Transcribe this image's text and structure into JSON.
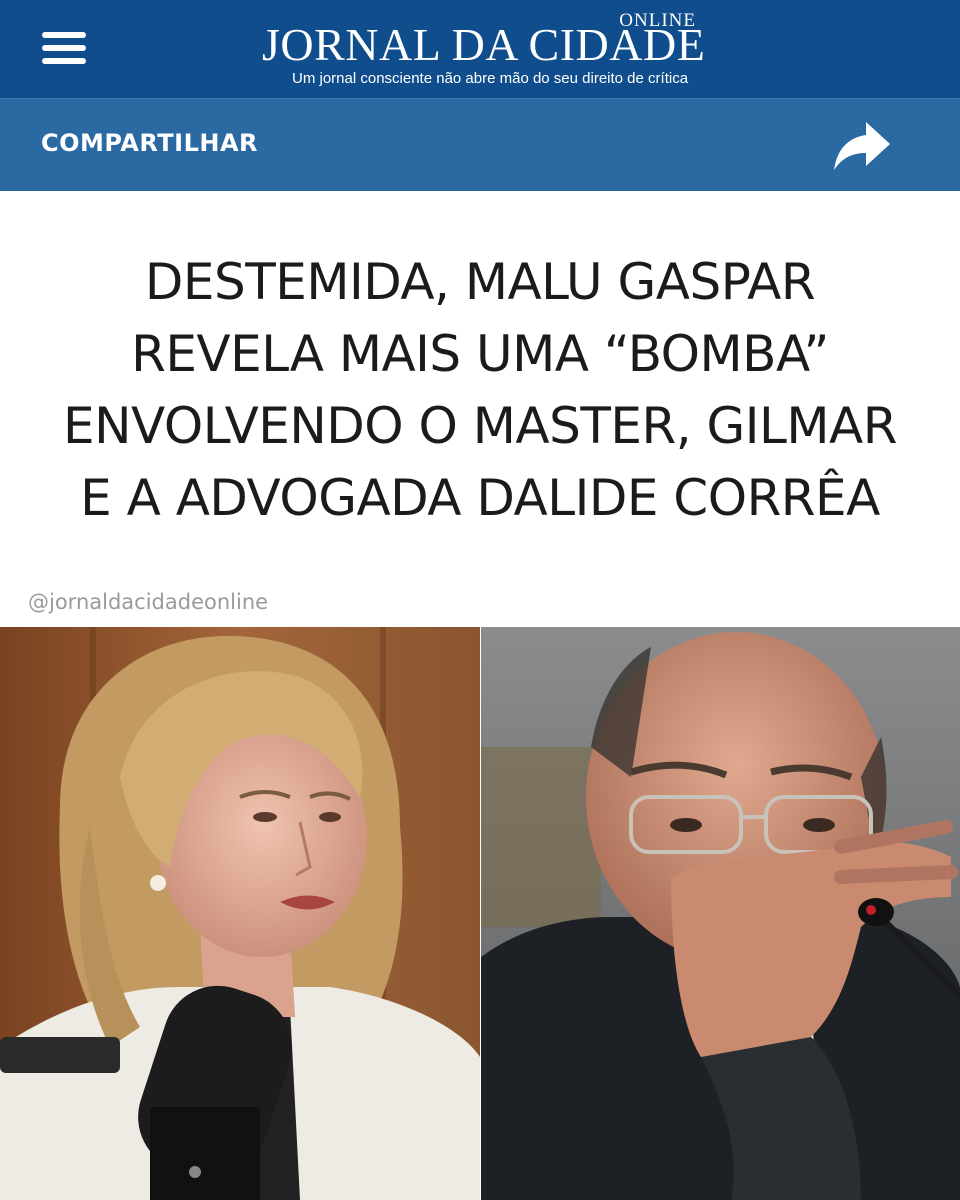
{
  "header": {
    "logo_online": "ONLINE",
    "logo_title": "JORNAL DA CIDADE",
    "logo_tagline": "Um jornal consciente não abre mão do seu direito de crítica",
    "menu_icon": "hamburger-menu-icon",
    "background_color": "#0f4d8c"
  },
  "sharebar": {
    "label": "COMPARTILHAR",
    "share_icon": "share-arrow-icon",
    "background_color": "#2b69a3"
  },
  "article": {
    "headline_lines": [
      "DESTEMIDA, MALU GASPAR",
      "REVELA MAIS UMA “BOMBA”",
      "ENVOLVENDO O MASTER, GILMAR",
      "E A ADVOGADA DALIDE CORRÊA"
    ],
    "handle": "@jornaldacidadeonline"
  }
}
